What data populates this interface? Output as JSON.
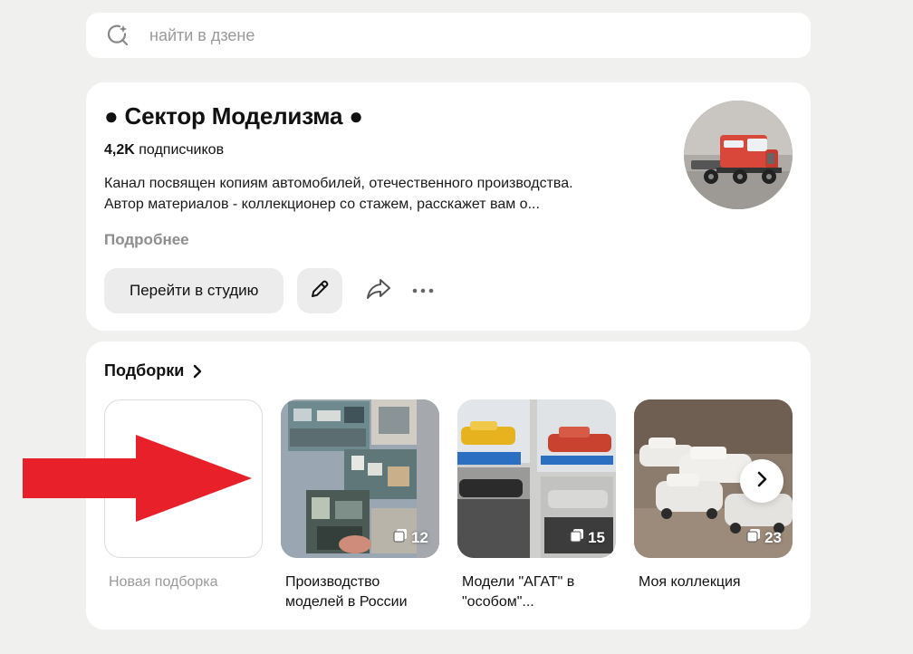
{
  "search": {
    "placeholder": "найти в дзене"
  },
  "channel": {
    "title": "● Сектор Моделизма ●",
    "subscribers_count": "4,2K",
    "subscribers_label": "подписчиков",
    "description_line1": "Канал посвящен копиям автомобилей, отечественного производства.",
    "description_line2": "Автор материалов - коллекционер со стажем, расскажет вам о...",
    "more_label": "Подробнее",
    "studio_button": "Перейти в студию"
  },
  "collections": {
    "header": "Подборки",
    "new_label": "Новая подборка",
    "items": [
      {
        "label": "Производство моделей в России",
        "count": "12"
      },
      {
        "label": "Модели \"АГАТ\" в \"особом\"...",
        "count": "15"
      },
      {
        "label": "Моя коллекция",
        "count": "23"
      }
    ]
  },
  "colors": {
    "background": "#f0f0ef",
    "annotation_arrow": "#e8202a"
  }
}
